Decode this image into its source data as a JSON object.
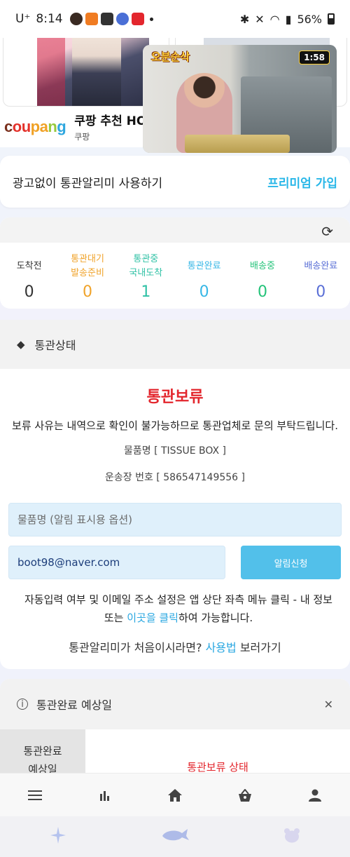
{
  "status_bar": {
    "carrier": "U⁺",
    "time": "8:14",
    "battery": "56%"
  },
  "ad": {
    "brand": "coupang",
    "brand_parts": [
      "c",
      "ou",
      "pa",
      "n",
      "g"
    ],
    "title": "쿠팡 추천 HO",
    "subtitle": "쿠팡"
  },
  "video": {
    "logo": "오분순삭",
    "duration": "1:58"
  },
  "premium": {
    "label": "광고없이 통관알리미 사용하기",
    "link": "프리미엄 가입"
  },
  "counts": {
    "columns": [
      {
        "label1": "도착전",
        "label2": "",
        "value": "0",
        "color": "#333333"
      },
      {
        "label1": "통관대기",
        "label2": "발송준비",
        "value": "0",
        "color": "#f0a32a"
      },
      {
        "label1": "통관중",
        "label2": "국내도착",
        "value": "1",
        "color": "#2fc1a5"
      },
      {
        "label1": "통관완료",
        "label2": "",
        "value": "0",
        "color": "#37b7e6"
      },
      {
        "label1": "배송중",
        "label2": "",
        "value": "0",
        "color": "#25c37a"
      },
      {
        "label1": "배송완료",
        "label2": "",
        "value": "0",
        "color": "#5a6fd6"
      }
    ]
  },
  "customs": {
    "section_title": "통관상태",
    "status": "통관보류",
    "notice": "보류 사유는 내역으로 확인이 불가능하므로 통관업체로 문의 부탁드립니다.",
    "item_line": "물품명 [ TISSUE BOX ]",
    "tracking_line": "운송장 번호 [ 586547149556 ]",
    "item_placeholder": "물품명 (알림 표시용 옵션)",
    "email_value": "boot98@naver.com",
    "notify_button": "알림신청",
    "help_text_1": "자동입력 여부 및 이메일 주소 설정은 앱 상단 좌측 메뉴 클릭 - 내 정보",
    "help_text_2a": "또는 ",
    "help_link": "이곳을 클릭",
    "help_text_2b": "하여 가능합니다.",
    "first_time_a": "통관알리미가 처음이시라면? ",
    "first_time_link": "사용법",
    "first_time_b": " 보러가기"
  },
  "expected": {
    "title": "통관완료 예상일",
    "label_line1": "통관완료",
    "label_line2": "예상일",
    "value": "통관보류 상태"
  },
  "bottom_nav": [
    "menu-icon",
    "chart-icon",
    "home-icon",
    "basket-icon",
    "person-icon"
  ],
  "system_bar": [
    "sparkle-icon",
    "whale-icon",
    "bear-icon"
  ]
}
